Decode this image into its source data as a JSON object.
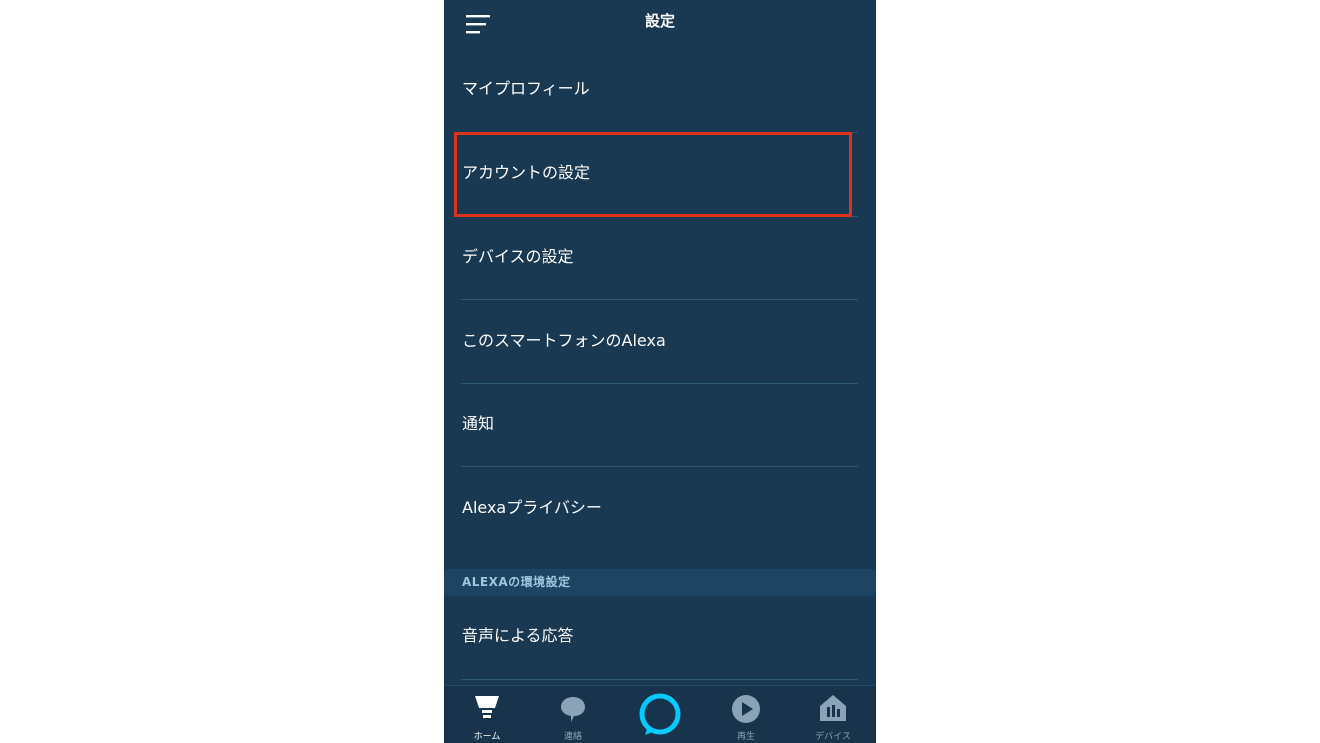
{
  "header": {
    "title": "設定",
    "menu_icon": "hamburger-menu-icon"
  },
  "settings_items": [
    {
      "label": "マイプロフィール"
    },
    {
      "label": "アカウントの設定"
    },
    {
      "label": "デバイスの設定"
    },
    {
      "label": "このスマートフォンのAlexa"
    },
    {
      "label": "通知"
    },
    {
      "label": "Alexaプライバシー"
    }
  ],
  "section": {
    "title": "ALEXAの環境設定"
  },
  "section_items": [
    {
      "label": "音声による応答"
    }
  ],
  "tabbar": {
    "tabs": [
      {
        "label": "ホーム",
        "icon": "home-lamp-icon",
        "active": true
      },
      {
        "label": "連絡",
        "icon": "chat-bubble-icon",
        "active": false
      },
      {
        "label": "",
        "icon": "alexa-ring-icon",
        "active": false
      },
      {
        "label": "再生",
        "icon": "play-icon",
        "active": false
      },
      {
        "label": "デバイス",
        "icon": "devices-house-icon",
        "active": false
      }
    ]
  },
  "colors": {
    "background": "#193851",
    "highlight_border": "#e0301e",
    "alexa_accent": "#00caff",
    "section_band": "#1d4463"
  }
}
